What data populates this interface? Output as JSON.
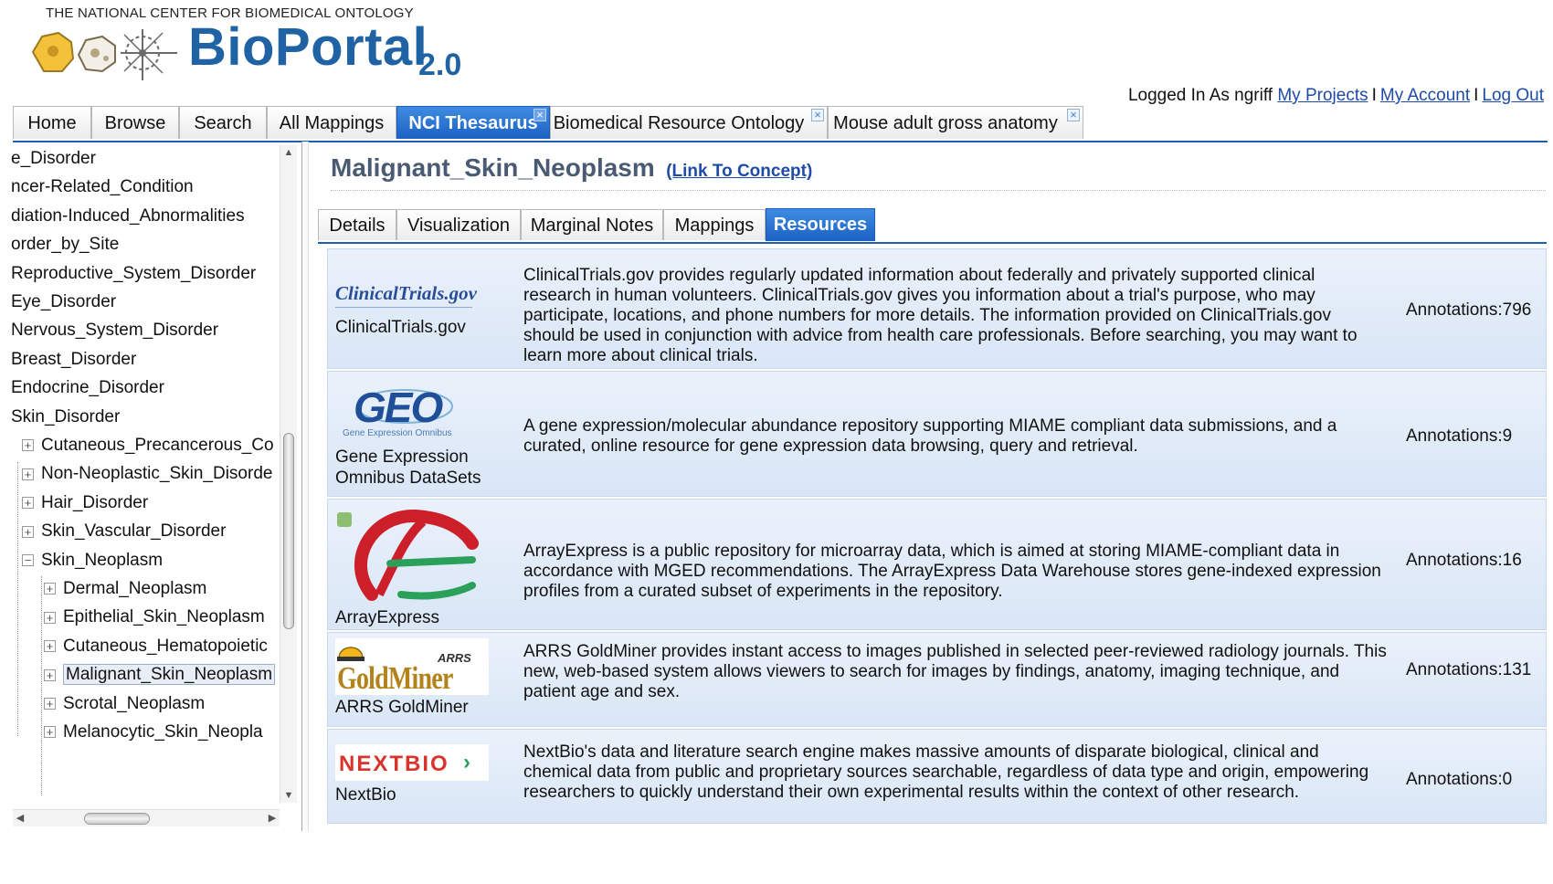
{
  "header": {
    "org_name": "THE NATIONAL CENTER FOR BIOMEDICAL ONTOLOGY",
    "logo_title": "BioPortal",
    "logo_version": "2.0",
    "logged_in_text": "Logged In As ngriff",
    "links": [
      "My Projects",
      "My Account",
      "Log Out"
    ],
    "separator": "I"
  },
  "main_tabs": [
    {
      "label": "Home"
    },
    {
      "label": "Browse"
    },
    {
      "label": "Search"
    },
    {
      "label": "All Mappings"
    },
    {
      "label": "NCI Thesaurus",
      "active": true,
      "closable": true
    },
    {
      "label": "Biomedical Resource Ontology",
      "closable": true
    },
    {
      "label": "Mouse adult gross anatomy",
      "closable": true
    }
  ],
  "tree": {
    "nodes": [
      {
        "label": "e_Disorder",
        "level": 0,
        "expander": ""
      },
      {
        "label": "ncer-Related_Condition",
        "level": 0,
        "expander": ""
      },
      {
        "label": "diation-Induced_Abnormalities",
        "level": 0,
        "expander": ""
      },
      {
        "label": "order_by_Site",
        "level": 0,
        "expander": ""
      },
      {
        "label": "Reproductive_System_Disorder",
        "level": 0,
        "expander": ""
      },
      {
        "label": "Eye_Disorder",
        "level": 0,
        "expander": ""
      },
      {
        "label": "Nervous_System_Disorder",
        "level": 0,
        "expander": ""
      },
      {
        "label": "Breast_Disorder",
        "level": 0,
        "expander": ""
      },
      {
        "label": "Endocrine_Disorder",
        "level": 0,
        "expander": ""
      },
      {
        "label": "Skin_Disorder",
        "level": 0,
        "expander": ""
      },
      {
        "label": "Cutaneous_Precancerous_Co",
        "level": 1,
        "expander": "+"
      },
      {
        "label": "Non-Neoplastic_Skin_Disorde",
        "level": 1,
        "expander": "+"
      },
      {
        "label": "Hair_Disorder",
        "level": 1,
        "expander": "+"
      },
      {
        "label": "Skin_Vascular_Disorder",
        "level": 1,
        "expander": "+"
      },
      {
        "label": "Skin_Neoplasm",
        "level": 1,
        "expander": "−"
      },
      {
        "label": "Dermal_Neoplasm",
        "level": 2,
        "expander": "+"
      },
      {
        "label": "Epithelial_Skin_Neoplasm",
        "level": 2,
        "expander": "+"
      },
      {
        "label": "Cutaneous_Hematopoietic",
        "level": 2,
        "expander": "+"
      },
      {
        "label": "Malignant_Skin_Neoplasm",
        "level": 2,
        "expander": "+",
        "selected": true
      },
      {
        "label": "Scrotal_Neoplasm",
        "level": 2,
        "expander": "+"
      },
      {
        "label": "Melanocytic_Skin_Neopla",
        "level": 2,
        "expander": "+"
      }
    ]
  },
  "concept": {
    "title": "Malignant_Skin_Neoplasm",
    "link_label": "(Link To Concept)"
  },
  "sub_tabs": [
    {
      "label": "Details"
    },
    {
      "label": "Visualization"
    },
    {
      "label": "Marginal Notes"
    },
    {
      "label": "Mappings"
    },
    {
      "label": "Resources",
      "active": true
    }
  ],
  "resources": [
    {
      "logo": "clinicaltrials-logo",
      "logo_text": "ClinicalTrials.gov",
      "name": "ClinicalTrials.gov",
      "description": "ClinicalTrials.gov provides regularly updated information about federally and privately supported clinical research in human volunteers. ClinicalTrials.gov gives you information about a trial's purpose, who may participate, locations, and phone numbers for more details. The information provided on ClinicalTrials.gov should be used in conjunction with advice from health care professionals. Before searching, you may want to learn more about clinical trials.",
      "annotations": "Annotations:796"
    },
    {
      "logo": "geo-logo",
      "logo_text": "GEO",
      "logo_subtext": "Gene Expression Omnibus",
      "name": "Gene Expression Omnibus DataSets",
      "description": "A gene expression/molecular abundance repository supporting MIAME compliant data submissions, and a curated, online resource for gene expression data browsing, query and retrieval.",
      "annotations": "Annotations:9"
    },
    {
      "logo": "arrayexpress-logo",
      "name": "ArrayExpress",
      "description": "ArrayExpress is a public repository for microarray data, which is aimed at storing MIAME-compliant data in accordance with MGED recommendations. The ArrayExpress Data Warehouse stores gene-indexed expression profiles from a curated subset of experiments in the repository.",
      "annotations": "Annotations:16"
    },
    {
      "logo": "goldminer-logo",
      "logo_text": "GoldMiner",
      "logo_subtext": "ARRS",
      "name": "ARRS GoldMiner",
      "description": "ARRS GoldMiner provides instant access to images published in selected peer-reviewed radiology journals. This new, web-based system allows viewers to search for images by findings, anatomy, imaging technique, and patient age and sex.",
      "annotations": "Annotations:131"
    },
    {
      "logo": "nextbio-logo",
      "logo_text": "NEXTBIO",
      "name": "NextBio",
      "description": "NextBio's data and literature search engine makes massive amounts of disparate biological, clinical and chemical data from public and proprietary sources searchable, regardless of data type and origin, empowering researchers to quickly understand their own experimental results within the context of other research.",
      "annotations": "Annotations:0"
    }
  ],
  "colors": {
    "brand_blue": "#1f63a5",
    "active_tab": "#1b62c4",
    "link": "#1f4aa8",
    "row_bg": "#dfe9f7"
  }
}
